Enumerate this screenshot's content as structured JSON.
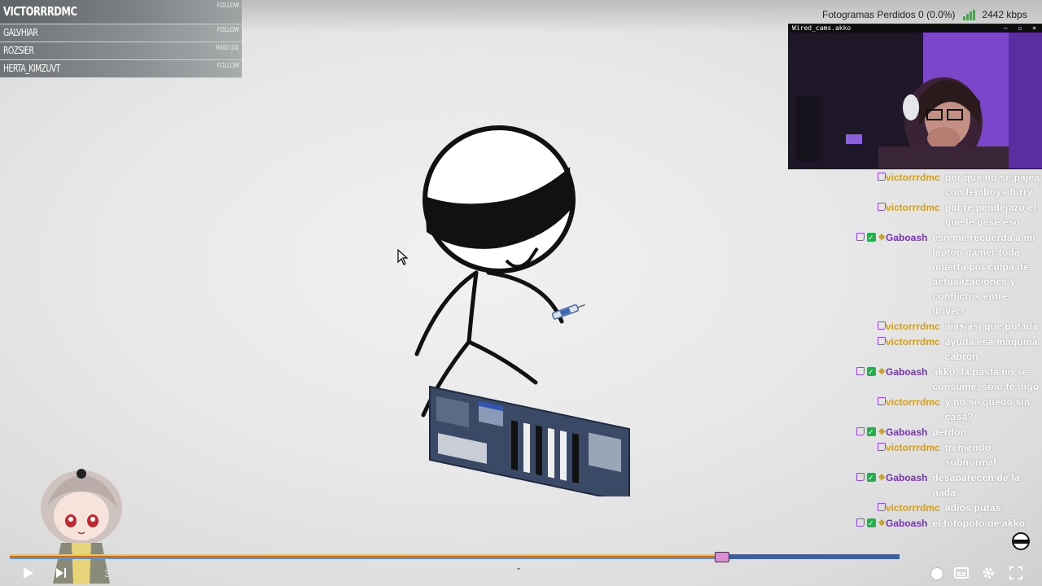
{
  "alerts": [
    {
      "name": "VICTORRRDMC",
      "tag": "FOLLOW"
    },
    {
      "name": "GALVHIAR",
      "tag": "FOLLOW"
    },
    {
      "name": "ROZSIER",
      "tag": "RAID (24)"
    },
    {
      "name": "HERTA_KIMZUVT",
      "tag": "FOLLOW"
    }
  ],
  "obs": {
    "frames_dropped": "Fotogramas Perdidos 0 (0.0%)",
    "bitrate": "2442 kbps"
  },
  "webcam": {
    "title": "Wired_cams.akko",
    "controls": "– ▫ ×"
  },
  "chat": [
    {
      "user": "victorrrdmc",
      "color": "#d4a017",
      "badges": [
        "twitch"
      ],
      "message": "por que no se pajea con femboys furry"
    },
    {
      "user": "victorrrdmc",
      "color": "#d4a017",
      "badges": [
        "twitch"
      ],
      "message": "pobre pendejazo el que le pase eso"
    },
    {
      "user": "Gaboash",
      "color": "#7a2fc0",
      "badges": [
        "twitch",
        "check",
        "bits"
      ],
      "message": "eso me recuerda a mi laptop gamer toda muerta por culpa de actualizaciones y conflictos entre drivers"
    },
    {
      "user": "victorrrdmc",
      "color": "#d4a017",
      "badges": [
        "twitch"
      ],
      "message": "ajasjasj que putada"
    },
    {
      "user": "victorrrdmc",
      "color": "#d4a017",
      "badges": [
        "twitch"
      ],
      "message": "ayuda esa maquina cabron"
    },
    {
      "user": "Gaboash",
      "color": "#7a2fc0",
      "badges": [
        "twitch",
        "check",
        "bits"
      ],
      "message": "akko, la pasta no se consume, solo te digo"
    },
    {
      "user": "victorrrdmc",
      "color": "#d4a017",
      "badges": [
        "twitch"
      ],
      "message": "y no se quedo sin casa?"
    },
    {
      "user": "Gaboash",
      "color": "#7a2fc0",
      "badges": [
        "twitch",
        "check",
        "bits"
      ],
      "message": "perdon"
    },
    {
      "user": "victorrrdmc",
      "color": "#d4a017",
      "badges": [
        "twitch"
      ],
      "message": "tremendo subnormal"
    },
    {
      "user": "Gaboash",
      "color": "#7a2fc0",
      "badges": [
        "twitch",
        "check",
        "bits"
      ],
      "message": "desaparecen de la nada"
    },
    {
      "user": "victorrrdmc",
      "color": "#d4a017",
      "badges": [
        "twitch"
      ],
      "message": "adios putas"
    },
    {
      "user": "Gaboash",
      "color": "#7a2fc0",
      "badges": [
        "twitch",
        "check",
        "bits"
      ],
      "message": "el fotopoto de akko"
    }
  ],
  "player": {
    "time": "3:17 / 4:41",
    "progress": 0.8
  },
  "icons": {
    "play": "play-icon",
    "next": "next-icon",
    "autoplay": "autoplay-toggle",
    "subtitles": "subtitles-icon",
    "settings": "gear-icon",
    "fullscreen": "fullscreen-icon"
  }
}
